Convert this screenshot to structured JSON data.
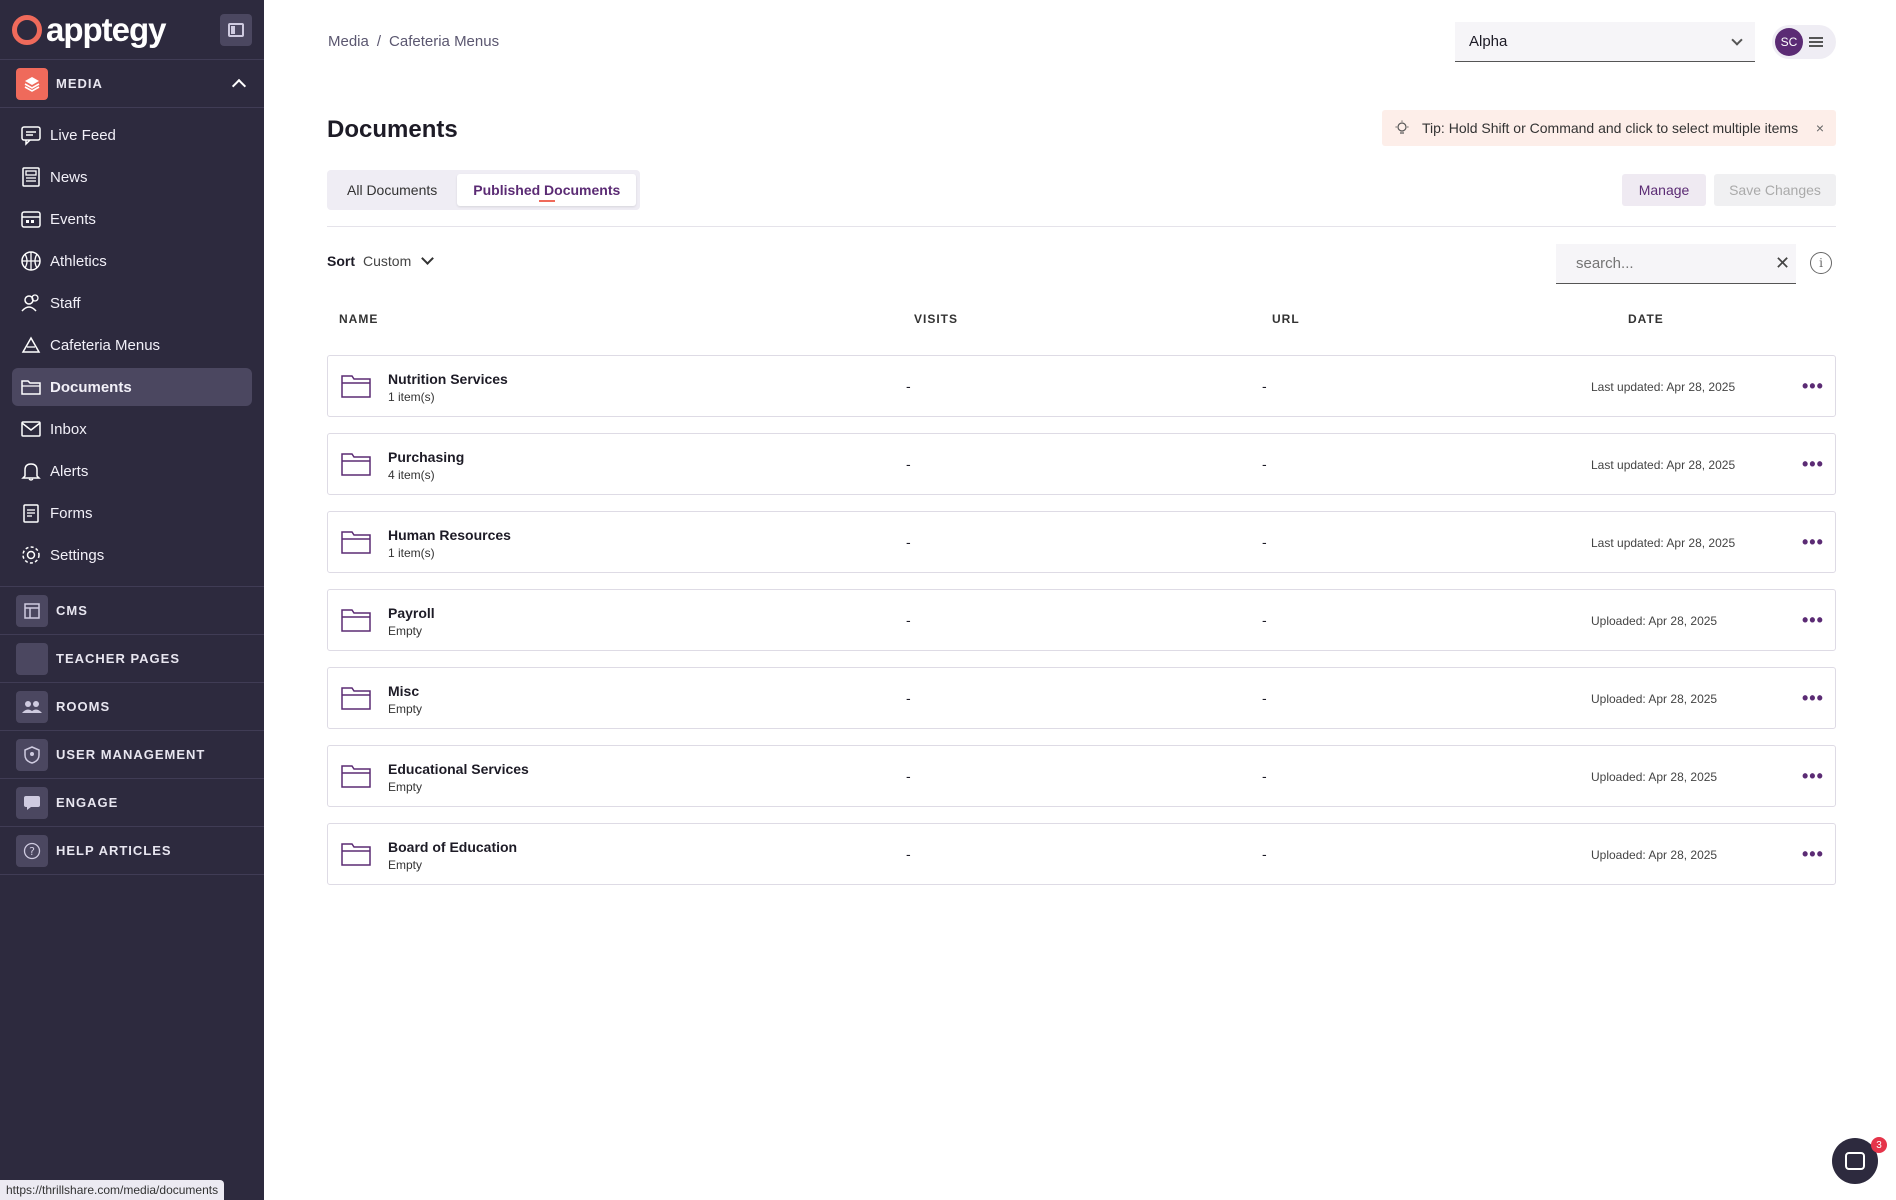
{
  "brand": {
    "name": "apptegy"
  },
  "sidebar": {
    "media_label": "MEDIA",
    "items": [
      {
        "label": "Live Feed",
        "icon": "feed-icon"
      },
      {
        "label": "News",
        "icon": "news-icon"
      },
      {
        "label": "Events",
        "icon": "calendar-icon"
      },
      {
        "label": "Athletics",
        "icon": "ball-icon"
      },
      {
        "label": "Staff",
        "icon": "staff-icon"
      },
      {
        "label": "Cafeteria Menus",
        "icon": "cafeteria-icon"
      },
      {
        "label": "Documents",
        "icon": "folder-icon"
      },
      {
        "label": "Inbox",
        "icon": "mail-icon"
      },
      {
        "label": "Alerts",
        "icon": "bell-icon"
      },
      {
        "label": "Forms",
        "icon": "forms-icon"
      },
      {
        "label": "Settings",
        "icon": "gear-icon"
      }
    ],
    "sections": [
      {
        "label": "CMS",
        "icon": "cms-icon"
      },
      {
        "label": "TEACHER PAGES",
        "icon": "teacher-icon"
      },
      {
        "label": "ROOMS",
        "icon": "rooms-icon"
      },
      {
        "label": "USER MANAGEMENT",
        "icon": "shield-icon"
      },
      {
        "label": "ENGAGE",
        "icon": "engage-icon"
      },
      {
        "label": "HELP ARTICLES",
        "icon": "help-icon"
      }
    ],
    "status_url": "https://thrillshare.com/media/documents"
  },
  "header": {
    "breadcrumb": [
      "Media",
      "Cafeteria Menus"
    ],
    "breadcrumb_sep": "/",
    "org_select": "Alpha",
    "user_initials": "SC"
  },
  "page": {
    "title": "Documents",
    "tip": "Tip: Hold Shift or Command and click to select multiple items",
    "tip_close": "×",
    "tabs": [
      "All Documents",
      "Published Documents"
    ],
    "manage_label": "Manage",
    "save_label": "Save Changes",
    "sort_label": "Sort",
    "sort_value": "Custom",
    "search_placeholder": "search...",
    "info": "i"
  },
  "table": {
    "columns": [
      "NAME",
      "VISITS",
      "URL",
      "DATE"
    ],
    "rows": [
      {
        "name": "Nutrition Services",
        "count": "1 item(s)",
        "visits": "-",
        "url": "-",
        "date": "Last updated: Apr 28, 2025"
      },
      {
        "name": "Purchasing",
        "count": "4 item(s)",
        "visits": "-",
        "url": "-",
        "date": "Last updated: Apr 28, 2025"
      },
      {
        "name": "Human Resources",
        "count": "1 item(s)",
        "visits": "-",
        "url": "-",
        "date": "Last updated: Apr 28, 2025"
      },
      {
        "name": "Payroll",
        "count": "Empty",
        "visits": "-",
        "url": "-",
        "date": "Uploaded: Apr 28, 2025"
      },
      {
        "name": "Misc",
        "count": "Empty",
        "visits": "-",
        "url": "-",
        "date": "Uploaded: Apr 28, 2025"
      },
      {
        "name": "Educational Services",
        "count": "Empty",
        "visits": "-",
        "url": "-",
        "date": "Uploaded: Apr 28, 2025"
      },
      {
        "name": "Board of Education",
        "count": "Empty",
        "visits": "-",
        "url": "-",
        "date": "Uploaded: Apr 28, 2025"
      }
    ],
    "more_label": "•••"
  },
  "chat": {
    "badge": "3"
  },
  "colors": {
    "sidebar": "#2d2a3e",
    "accent": "#5b2b74",
    "brand": "#ef6a5b"
  }
}
